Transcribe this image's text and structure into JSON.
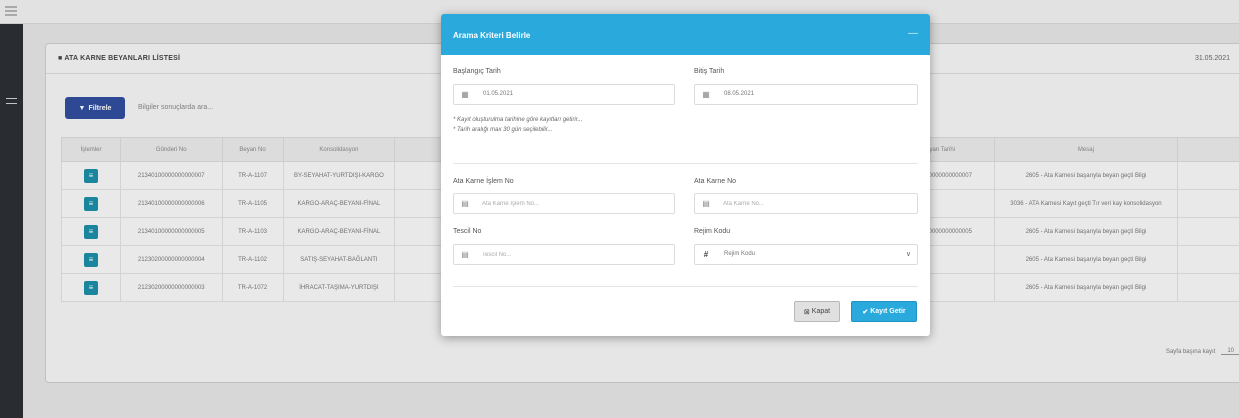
{
  "background": {
    "panel_title": "■ ATA KARNE BEYANLARI LİSTESİ",
    "panel_date": "31.05.2021",
    "filter_button": "Filtrele",
    "filter_hint": "Bilgiler sonuçlarda ara...",
    "columns": [
      "İşlemler",
      "Gönderi No",
      "Beyan No",
      "Konsolidasyon",
      "",
      "",
      "",
      "",
      "Beyan Tarihi",
      "Mesaj",
      ""
    ],
    "rows": [
      {
        "gonderi": "21340100000000000007",
        "beyan": "TR-A-1107",
        "kons": "BY-SEYAHAT-YURTDIŞI-KARGO",
        "ref": "21340100000000000007",
        "mesaj": "2605 - Ata Karnesi başarıyla beyan geçti Bilgi"
      },
      {
        "gonderi": "21340100000000000006",
        "beyan": "TR-A-1105",
        "kons": "KARGO-ARAÇ-BEYANI-FİNAL",
        "ref": "",
        "mesaj": "3036 - ATA Karnesi Kayıt geçti Tır veri kay konsolidasyon"
      },
      {
        "gonderi": "21340100000000000005",
        "beyan": "TR-A-1103",
        "kons": "KARGO-ARAÇ-BEYANI-FİNAL",
        "ref": "21340100000000000005",
        "mesaj": "2605 - Ata Karnesi başarıyla beyan geçti Bilgi"
      },
      {
        "gonderi": "21230200000000000004",
        "beyan": "TR-A-1102",
        "kons": "SATIŞ-SEYAHAT-BAĞLANTI",
        "ref": "",
        "mesaj": "2605 - Ata Karnesi başarıyla beyan geçti Bilgi"
      },
      {
        "gonderi": "21230200000000000003",
        "beyan": "TR-A-1072",
        "kons": "İHRACAT-TAŞIMA-YURTDIŞI",
        "ref": "",
        "mesaj": "2605 - Ata Karnesi başarıyla beyan geçti Bilgi"
      }
    ],
    "pager_label": "Sayfa başına kayıt",
    "pager_value": "10"
  },
  "modal": {
    "title": "Arama Kriteri Belirle",
    "start_label": "Başlangıç Tarih",
    "start_value": "01.05.2021",
    "end_label": "Bitiş Tarih",
    "end_value": "08.05.2021",
    "note1": "* Kayıt oluşturulma tarihine göre kayıtları getirir...",
    "note2": "* Tarih aralığı max 30 gün seçilebilir...",
    "islem_label": "Ata Karne İşlem No",
    "islem_placeholder": "Ata Karne İşlem No...",
    "karne_label": "Ata Karne No",
    "karne_placeholder": "Ata Karne No...",
    "tescil_label": "Tescil No",
    "tescil_placeholder": "Tescil No...",
    "rejim_label": "Rejim Kodu",
    "rejim_value": "Rejim Kodu",
    "close_button": "Kapat",
    "apply_button": "Kayıt Getir"
  }
}
